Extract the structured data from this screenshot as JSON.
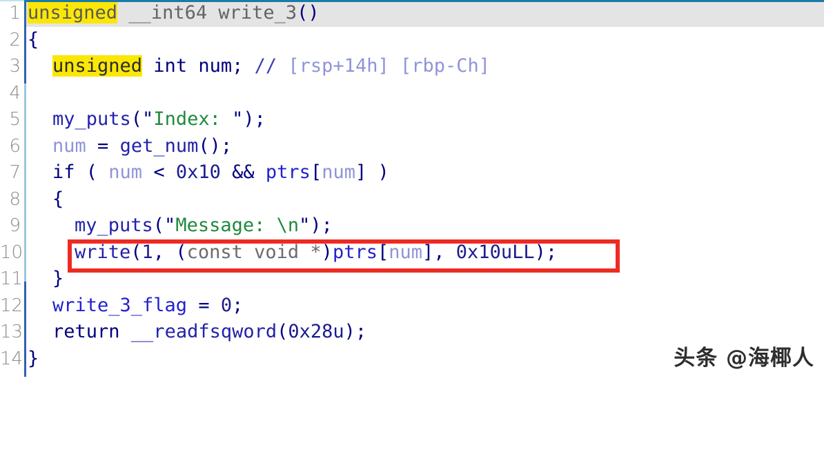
{
  "editor": {
    "kind": "decompiler-pseudocode-view",
    "function_name": "write_3",
    "gutter_line_numbers": [
      "1",
      "2",
      "3",
      "4",
      "5",
      "6",
      "7",
      "8",
      "9",
      "10",
      "11",
      "12",
      "13",
      "14"
    ],
    "current_line": 1,
    "highlighted_token": "unsigned",
    "annotation": {
      "type": "rectangle",
      "color": "#ee2b23",
      "target_line": 10,
      "target_text": "write(1, (const void *)ptrs[num], 0x10uLL);"
    },
    "colors": {
      "background": "#ffffff",
      "current_line_band": "#e4e4e4",
      "highlight_yellow": "#fbe706",
      "keyword": "#000080",
      "string": "#1f8a3c",
      "comment": "#8f94d6",
      "local_var": "#8f94d6",
      "global_var": "#2222cc",
      "type_cast": "#6b6b6b",
      "line_number": "#8a8a8a",
      "gutter_rule": "#2e63b0",
      "top_rule": "#1a7aa8",
      "annotation_red": "#ee2b23"
    },
    "lines": [
      {
        "n": "1",
        "text": "unsigned __int64 write_3()"
      },
      {
        "n": "2",
        "text": "{"
      },
      {
        "n": "3",
        "text": "  unsigned int num; // [rsp+14h] [rbp-Ch]"
      },
      {
        "n": "4",
        "text": ""
      },
      {
        "n": "5",
        "text": "  my_puts(\"Index: \");"
      },
      {
        "n": "6",
        "text": "  num = get_num();"
      },
      {
        "n": "7",
        "text": "  if ( num < 0x10 && ptrs[num] )"
      },
      {
        "n": "8",
        "text": "  {"
      },
      {
        "n": "9",
        "text": "    my_puts(\"Message: \\n\");"
      },
      {
        "n": "10",
        "text": "    write(1, (const void *)ptrs[num], 0x10uLL);"
      },
      {
        "n": "11",
        "text": "  }"
      },
      {
        "n": "12",
        "text": "  write_3_flag = 0;"
      },
      {
        "n": "13",
        "text": "  return __readfsqword(0x28u);"
      },
      {
        "n": "14",
        "text": "}"
      }
    ],
    "tokens": {
      "l1_unsigned": "unsigned",
      "l1_rest": " __int64 write_3",
      "l1_parens": "()",
      "l2_brace": "{",
      "l3_unsigned": "unsigned",
      "l3_decl": " int num;",
      "l3_slashes": "//",
      "l3_comment": "[rsp+14h] [rbp-Ch]",
      "l5_func": "my_puts",
      "l5_open": "(\"",
      "l5_str": "Index: ",
      "l5_close": "\");",
      "l6_var": "num",
      "l6_eq": " = ",
      "l6_func": "get_num",
      "l6_tail": "();",
      "l7_if": "if ( ",
      "l7_num": "num",
      "l7_op": " < ",
      "l7_hex": "0x10",
      "l7_and": " && ",
      "l7_ptrs": "ptrs",
      "l7_lb": "[",
      "l7_idx": "num",
      "l7_rb": "] )",
      "l8_brace": "{",
      "l9_func": "my_puts",
      "l9_open": "(\"",
      "l9_str": "Message: \\n",
      "l9_close": "\");",
      "l10_func": "write",
      "l10_open": "(",
      "l10_one": "1",
      "l10_comma": ", ",
      "l10_castopen": "(",
      "l10_cast": "const void *",
      "l10_castclose": ")",
      "l10_ptrs": "ptrs",
      "l10_lb": "[",
      "l10_idx": "num",
      "l10_rb": "]",
      "l10_comma2": ", ",
      "l10_size": "0x10uLL",
      "l10_tail": ");",
      "l11_brace": "}",
      "l12_flag": "write_3_flag",
      "l12_assign": " = ",
      "l12_zero": "0",
      "l12_semi": ";",
      "l13_return": "return ",
      "l13_func": "__readfsqword",
      "l13_open": "(",
      "l13_arg": "0x28u",
      "l13_tail": ");",
      "l14_brace": "}"
    }
  },
  "watermark": {
    "text": "头条 @海椰人"
  }
}
